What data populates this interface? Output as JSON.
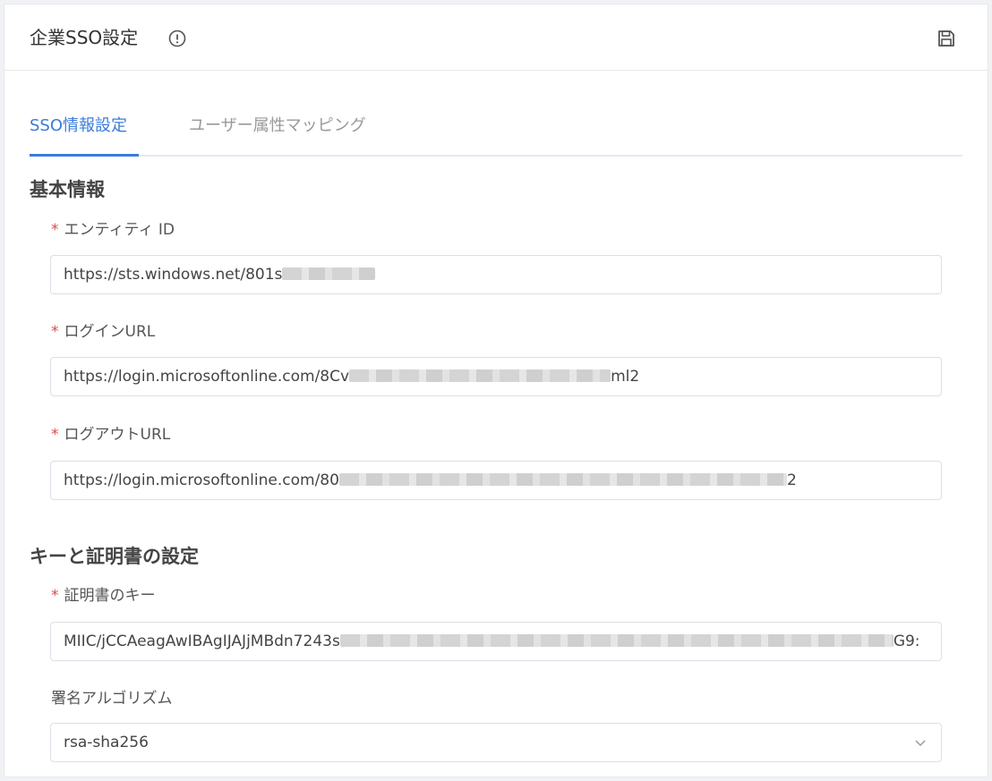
{
  "header": {
    "title": "企業SSO設定",
    "info_icon": "info-circle-icon",
    "save_icon": "save-icon"
  },
  "tabs": [
    {
      "label": "SSO情報設定",
      "active": true
    },
    {
      "label": "ユーザー属性マッピング",
      "active": false
    }
  ],
  "basic_info": {
    "title": "基本情報",
    "entity_id": {
      "label": "エンティティ ID",
      "required": "*",
      "value_prefix": "https://sts.windows.net/801s",
      "value_suffix": ""
    },
    "login_url": {
      "label": "ログインURL",
      "required": "*",
      "value_prefix": "https://login.microsoftonline.com/8Cv",
      "value_suffix": "ml2"
    },
    "logout_url": {
      "label": "ログアウトURL",
      "required": "*",
      "value_prefix": "https://login.microsoftonline.com/80",
      "value_suffix": "2"
    }
  },
  "key_cert": {
    "title": "キーと証明書の設定",
    "cert_key": {
      "label": "証明書のキー",
      "required": "*",
      "value_prefix": "MIIC/jCCAeagAwIBAgIJAJjMBdn7243s",
      "value_suffix": "G9:"
    },
    "signature_algorithm": {
      "label": "署名アルゴリズム",
      "value": "rsa-sha256",
      "arrow_icon": "chevron-down-icon"
    }
  },
  "colors": {
    "accent": "#3b7bdb",
    "required": "#e54545"
  }
}
